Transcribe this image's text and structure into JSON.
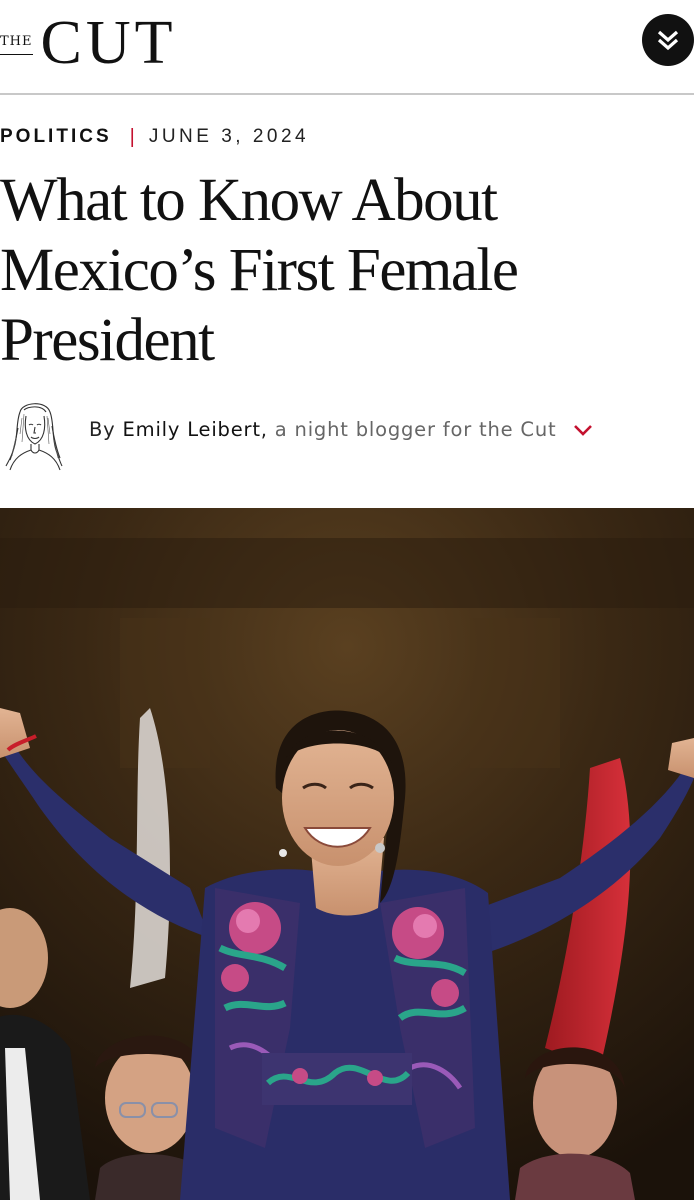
{
  "header": {
    "logo_the": "THE",
    "logo_cut": "CUT",
    "menu_icon": "double-chevron-down-icon"
  },
  "article": {
    "section": "POLITICS",
    "separator": "|",
    "date": "JUNE 3, 2024",
    "title": "What to Know About Mexico’s First Female President",
    "byline_prefix": "By ",
    "author": "Emily Leibert",
    "byline_comma": ",",
    "author_role": " a night blogger for the Cut",
    "byline_toggle_icon": "chevron-down-icon"
  },
  "colors": {
    "accent_red": "#c4112f",
    "text": "#111111"
  }
}
